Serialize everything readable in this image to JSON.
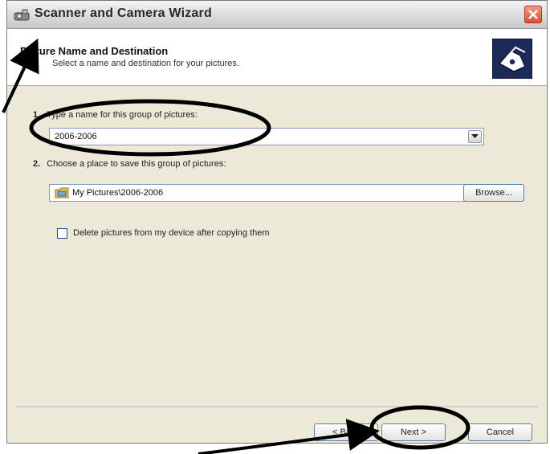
{
  "window": {
    "title": "Scanner and Camera Wizard"
  },
  "header": {
    "title": "Picture Name and Destination",
    "subtitle": "Select a name and destination for your pictures."
  },
  "step1": {
    "number": "1.",
    "label": "Type a name for this group of pictures:",
    "value": "2006-2006"
  },
  "step2": {
    "number": "2.",
    "label": "Choose a place to save this group of pictures:",
    "value": "My Pictures\\2006-2006",
    "browse_label": "Browse..."
  },
  "options": {
    "delete_label": "Delete pictures from my device after copying them",
    "delete_checked": false
  },
  "footer": {
    "back_label": "< Back",
    "next_label": "Next >",
    "cancel_label": "Cancel"
  },
  "colors": {
    "title_gradient_top": "#f4f4f4",
    "panel": "#ece9d8",
    "annotation": "#000000"
  }
}
